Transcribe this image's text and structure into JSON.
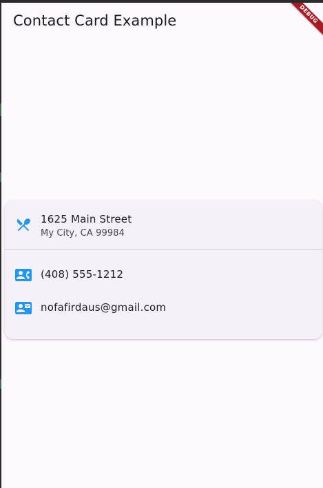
{
  "app_bar": {
    "title": "Contact Card Example",
    "debug_banner": "DEBUG"
  },
  "card": {
    "address": {
      "icon": "restaurant-menu-icon",
      "street": "1625 Main Street",
      "city": "My City, CA 99984"
    },
    "phone": {
      "icon": "contact-phone-icon",
      "number": "(408) 555-1212"
    },
    "email": {
      "icon": "contact-mail-icon",
      "address": "nofafirdaus@gmail.com"
    }
  },
  "colors": {
    "background": "#fdf7fe",
    "card": "#f6f1f9",
    "icon": "#2196f3",
    "debug_banner": "#a81c25",
    "divider": "#cac4d0"
  }
}
